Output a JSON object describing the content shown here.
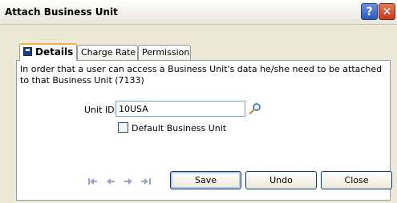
{
  "window": {
    "title": "Attach Business Unit",
    "help_glyph": "?",
    "close_glyph": "✕"
  },
  "tabs": [
    {
      "label": "Details",
      "icon": "save-icon",
      "active": true
    },
    {
      "label": "Charge Rate",
      "active": false
    },
    {
      "label": "Permission",
      "active": false
    }
  ],
  "details": {
    "info_text": "In order that a user can access a Business Unit's data he/she need to be attached to that Business Unit (7133)",
    "unit_id_label": "Unit ID:",
    "unit_id_value": "10USA",
    "default_label": "Default Business Unit",
    "default_checked": false
  },
  "navigation": {
    "icons": [
      "first-record-icon",
      "previous-record-icon",
      "next-record-icon",
      "last-record-icon"
    ]
  },
  "buttons": {
    "save": "Save",
    "undo": "Undo",
    "close": "Close"
  }
}
